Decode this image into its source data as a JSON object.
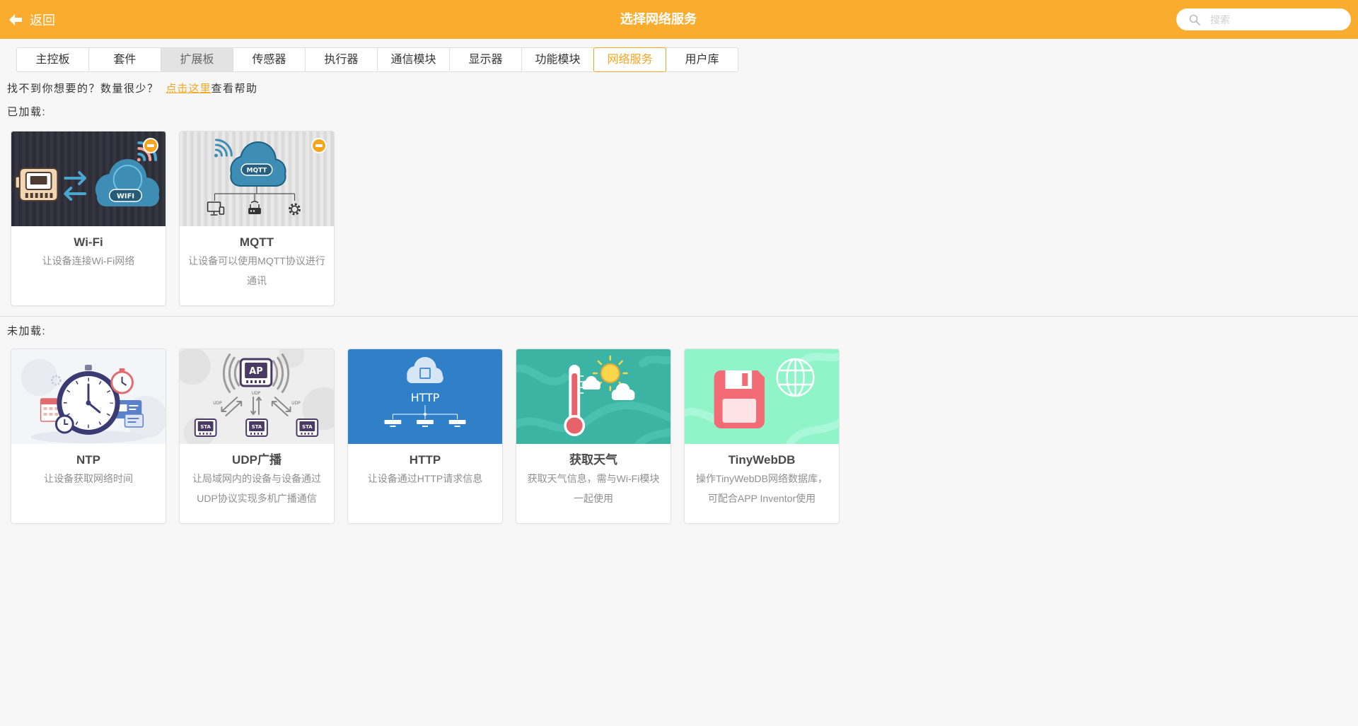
{
  "colors": {
    "accent": "#F9AC2E",
    "active_tab": "#F5A623",
    "page_bg": "#F7F7F7"
  },
  "header": {
    "back_icon": "arrow-left-icon",
    "back_label": "返回",
    "title": "选择网络服务",
    "search_icon": "search-icon",
    "search_placeholder": "搜索"
  },
  "tabs": [
    {
      "label": "主控板"
    },
    {
      "label": "套件"
    },
    {
      "label": "扩展板",
      "highlighted": true
    },
    {
      "label": "传感器"
    },
    {
      "label": "执行器"
    },
    {
      "label": "通信模块"
    },
    {
      "label": "显示器"
    },
    {
      "label": "功能模块"
    },
    {
      "label": "网络服务",
      "selected": true
    },
    {
      "label": "用户库"
    }
  ],
  "help": {
    "prefix": "找不到你想要的？数量很少？",
    "link": "点击这里",
    "suffix": "查看帮助"
  },
  "loaded": {
    "label": "已加载:",
    "cards": [
      {
        "title": "Wi-Fi",
        "desc": "让设备连接Wi-Fi网络",
        "art_label": "WIFI",
        "remove_icon": "minus-circle-icon"
      },
      {
        "title": "MQTT",
        "desc": "让设备可以使用MQTT协议进行通讯",
        "art_label": "MQTT",
        "remove_icon": "minus-circle-icon"
      }
    ]
  },
  "unloaded": {
    "label": "未加载:",
    "cards": [
      {
        "title": "NTP",
        "desc": "让设备获取网络时间"
      },
      {
        "title": "UDP广播",
        "desc": "让局域网内的设备与设备通过UDP协议实现多机广播通信",
        "art_labels": {
          "ap": "AP",
          "udp": "UDP",
          "sta": "STA"
        }
      },
      {
        "title": "HTTP",
        "desc": "让设备通过HTTP请求信息",
        "art_label": "HTTP"
      },
      {
        "title": "获取天气",
        "desc": "获取天气信息，需与Wi-Fi模块一起使用"
      },
      {
        "title": "TinyWebDB",
        "desc": "操作TinyWebDB网络数据库，可配合APP Inventor使用"
      }
    ]
  }
}
